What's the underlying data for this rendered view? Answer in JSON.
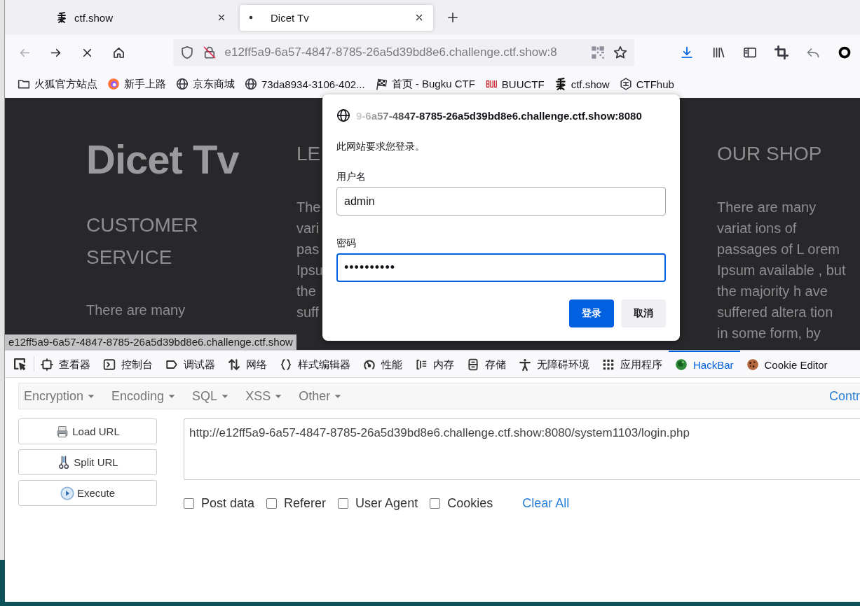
{
  "tabs": [
    {
      "title": "ctf.show",
      "selected": false
    },
    {
      "title": "Dicet Tv",
      "selected": true
    }
  ],
  "nav_buttons": [
    {
      "kind": "back",
      "disabled": true
    },
    {
      "kind": "forward",
      "disabled": false
    },
    {
      "kind": "stop",
      "disabled": false
    },
    {
      "kind": "home",
      "disabled": false
    }
  ],
  "address_bar": {
    "url": "e12ff5a9-6a57-4847-8785-26a5d39bd8e6.challenge.ctf.show:8"
  },
  "bookmarks": [
    {
      "label": "火狐官方站点"
    },
    {
      "label": "新手上路"
    },
    {
      "label": "京东商城"
    },
    {
      "label": "73da8934-3106-402..."
    },
    {
      "label": "首页 - Bugku CTF"
    },
    {
      "label": "BUUCTF"
    },
    {
      "label": "ctf.show"
    },
    {
      "label": "CTFhub"
    }
  ],
  "page": {
    "logo": "Dicet Tv",
    "columns": [
      {
        "heading": "CUSTOMER\nSERVICE",
        "text": "There are many"
      },
      {
        "heading": "LE",
        "text": "The\nvari\npas\nIpsu\nthe\nsuff"
      },
      {
        "heading": "OUR SHOP",
        "text": "There are many\nvariat ions of\npassages of L orem\nIpsum available , but\nthe majority h ave\nsuffered altera tion\nin some form, by"
      }
    ]
  },
  "status_link": "e12ff5a9-6a57-4847-8785-26a5d39bd8e6.challenge.ctf.show",
  "login_dialog": {
    "origin": "9-6a57-4847-8785-26a5d39bd8e6.challenge.ctf.show:8080",
    "message": "此网站要求您登录。",
    "username_label": "用户名",
    "username": "admin",
    "password_label": "密码",
    "password": "••••••••••",
    "buttons": [
      {
        "label": "登录",
        "kind": "primary"
      },
      {
        "label": "取消",
        "kind": "secondary"
      }
    ]
  },
  "devtools_tabs": [
    {
      "label": "查看器",
      "selected": false
    },
    {
      "label": "控制台",
      "selected": false
    },
    {
      "label": "调试器",
      "selected": false
    },
    {
      "label": "网络",
      "selected": false
    },
    {
      "label": "样式编辑器",
      "selected": false
    },
    {
      "label": "性能",
      "selected": false
    },
    {
      "label": "内存",
      "selected": false
    },
    {
      "label": "存储",
      "selected": false
    },
    {
      "label": "无障碍环境",
      "selected": false
    },
    {
      "label": "应用程序",
      "selected": false
    },
    {
      "label": "HackBar",
      "selected": true
    },
    {
      "label": "Cookie Editor",
      "selected": false
    }
  ],
  "hackbar": {
    "menus": [
      "Encryption",
      "Encoding",
      "SQL",
      "XSS",
      "Other"
    ],
    "menu_right": "Contr",
    "actions": [
      {
        "label": "Load URL"
      },
      {
        "label": "Split URL"
      },
      {
        "label": "Execute"
      }
    ],
    "url": "http://e12ff5a9-6a57-4847-8785-26a5d39bd8e6.challenge.ctf.show:8080/system1103/login.php",
    "options": [
      {
        "label": "Post data",
        "checked": false
      },
      {
        "label": "Referer",
        "checked": false
      },
      {
        "label": "User Agent",
        "checked": false
      },
      {
        "label": "Cookies",
        "checked": false
      }
    ],
    "clear": "Clear All"
  }
}
